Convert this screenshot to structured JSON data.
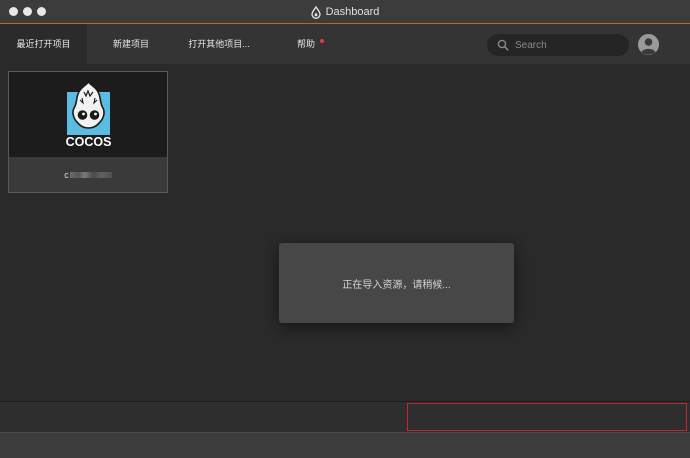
{
  "window": {
    "title": "Dashboard"
  },
  "nav": {
    "tabs": [
      {
        "label": "最近打开项目",
        "active": true
      },
      {
        "label": "新建项目",
        "active": false
      },
      {
        "label": "打开其他项目...",
        "active": false
      },
      {
        "label": "帮助",
        "active": false,
        "has_notification_dot": true
      }
    ],
    "search": {
      "placeholder": "Search",
      "value": ""
    }
  },
  "projects": [
    {
      "name_visible": "c",
      "name_obscured": true,
      "logo_text": "COCOS"
    }
  ],
  "dialog": {
    "message": "正在导入资源，请稍候..."
  },
  "colors": {
    "titlebar_accent": "#b56a25",
    "notification_dot": "#e03c3c",
    "highlight_border": "#c0292b",
    "logo_blue": "#5bbbe0"
  },
  "icons": {
    "title": "cocos-drop-icon",
    "search": "search-icon",
    "avatar": "user-avatar-icon"
  }
}
